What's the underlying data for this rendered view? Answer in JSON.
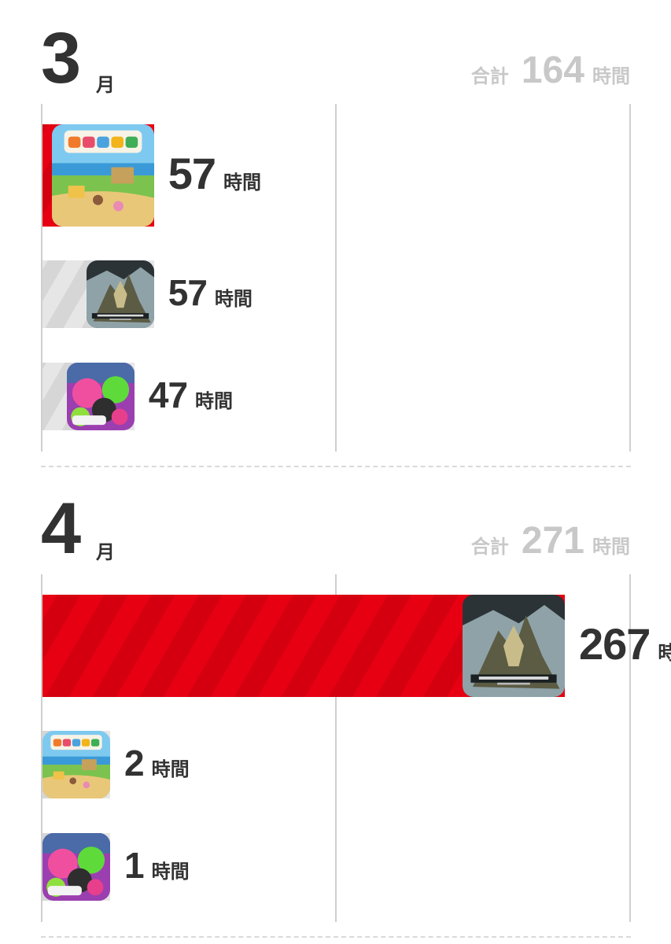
{
  "chart_data": [
    {
      "type": "bar",
      "title": "3",
      "title_unit": "月",
      "total_label": "合計",
      "total_value": "164",
      "total_unit": "時間",
      "value_unit": "時間",
      "orientation": "horizontal",
      "xlim": [
        0,
        300
      ],
      "grid": true,
      "categories": [
        "あつまれ どうぶつの森",
        "MONSTER HUNTER RISE",
        "Splatoon 2"
      ],
      "values": [
        57,
        57,
        47
      ],
      "highlight_index": 0
    },
    {
      "type": "bar",
      "title": "4",
      "title_unit": "月",
      "total_label": "合計",
      "total_value": "271",
      "total_unit": "時間",
      "value_unit": "時間",
      "orientation": "horizontal",
      "xlim": [
        0,
        300
      ],
      "grid": true,
      "categories": [
        "MONSTER HUNTER RISE",
        "あつまれ どうぶつの森",
        "Splatoon 2"
      ],
      "values": [
        267,
        2,
        1
      ],
      "highlight_index": 0
    }
  ],
  "colors": {
    "highlight": "#e60012",
    "other": "#dcdcdc",
    "muted_text": "#c8c8c8",
    "text": "#323232"
  },
  "icons": {
    "animal_crossing": "animal-crossing-cover-icon",
    "monster_hunter": "monster-hunter-rise-cover-icon",
    "splatoon": "splatoon2-cover-icon"
  }
}
